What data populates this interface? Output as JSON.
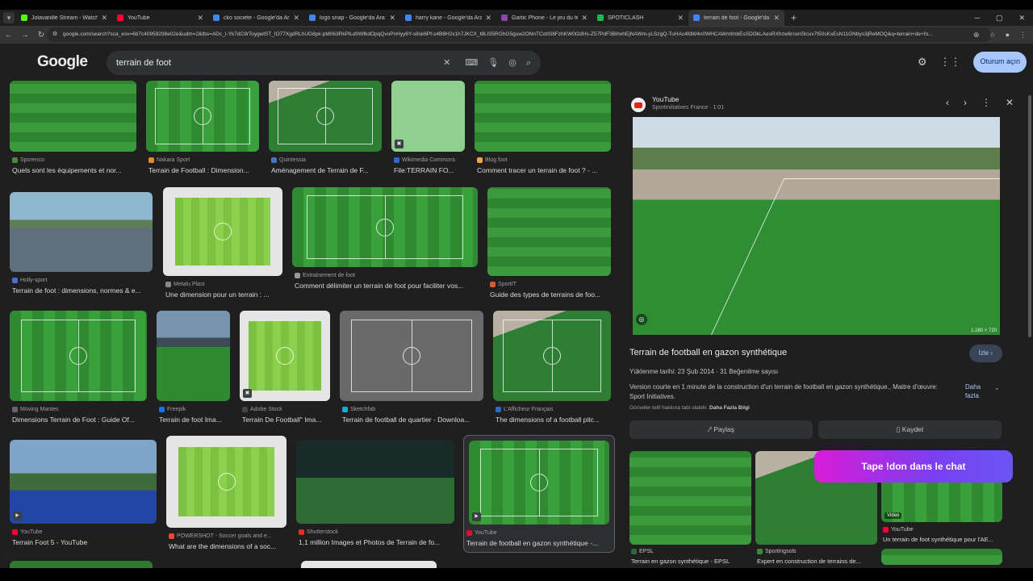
{
  "browser": {
    "tabs": [
      {
        "title": "Jolavanille Stream - Watch Live",
        "color": "#53fc18"
      },
      {
        "title": "YouTube",
        "color": "#ff0033"
      },
      {
        "title": "cko societe - Google'da Ara",
        "color": "#4285f4"
      },
      {
        "title": "logo snap - Google'da Ara",
        "color": "#4285f4"
      },
      {
        "title": "harry kane - Google'da Ara",
        "color": "#4285f4"
      },
      {
        "title": "Gartic Phone - Le jeu du télép",
        "color": "#8e44ad"
      },
      {
        "title": "SPOTICLASH",
        "color": "#1db954"
      },
      {
        "title": "terrain de foot - Google'da Ara",
        "color": "#4285f4"
      }
    ],
    "url": "google.com/search?sca_esv=6b7c40959298e02e&udm=2&tbs=ADc_I-Yk7dC9rToygwlST_IO77XgdRLhUG8pk-pM063RkPlLd0WfkdOpqQvoPnHyy6Y-s8sk6Pf-s4B8H2x1h7JKCX_t8LlS5RGhG5guw2ONnTCotIS8FzhKW0t2dHs-Z57PdF3BihvhEjNAWm-yLSzgQ-TuHAc4fdW4n0WHCAWmfmbEsSDl3kLAesRXhzw6rcenSlcuv7t50sKsEsN11GNbys3jReMOQ&q=terrain+de+fo..."
  },
  "header": {
    "logo": "Google",
    "query": "terrain de foot",
    "signin": "Oturum açın"
  },
  "results": [
    {
      "source": "Sporenco",
      "title": "Quels sont les équipements et nor...",
      "color": "#4a8a3a"
    },
    {
      "source": "Nakara Sport",
      "title": "Terrain de Football : Dimension...",
      "color": "#e88a2a"
    },
    {
      "source": "Quintessia",
      "title": "Aménagement de Terrain de F...",
      "color": "#3a7ac8"
    },
    {
      "source": "Wikimedia Commons",
      "title": "File:TERRAIN FO...",
      "color": "#3366cc"
    },
    {
      "source": "Blog foot",
      "title": "Comment tracer un terrain de foot ? - ...",
      "color": "#f4a442"
    },
    {
      "source": "Holly-sport",
      "title": "Terrain de foot : dimensions, normes & e...",
      "color": "#4a6ed8"
    },
    {
      "source": "Metalu Plast",
      "title": "Une dimension pour un terrain : ...",
      "color": "#888888"
    },
    {
      "source": "Entrainement de foot",
      "title": "Comment délimiter un terrain de foot pour faciliter vos...",
      "color": "#999999"
    },
    {
      "source": "SportIT",
      "title": "Guide des types de terrains de foo...",
      "color": "#d85c2a"
    },
    {
      "source": "Moving Mantes",
      "title": "Dimensions Terrain de Foot : Guide Of...",
      "color": "#666666"
    },
    {
      "source": "Freepik",
      "title": "Terrain de foot Ima...",
      "color": "#1273eb"
    },
    {
      "source": "Adobe Stock",
      "title": "Terrain De Football\" Ima...",
      "color": "#444444"
    },
    {
      "source": "Sketchfab",
      "title": "Terrain de football de quartier - Downloa...",
      "color": "#1caad9"
    },
    {
      "source": "L'Afficheur Français",
      "title": "The dimensions of a football pitc...",
      "color": "#2a6ac8"
    },
    {
      "source": "YouTube",
      "title": "Terrain Foot 5 - YouTube",
      "color": "#ff0033"
    },
    {
      "source": "POWERSHOT - Soccer goals and e...",
      "title": "What are the dimensions of a soc...",
      "color": "#e84a2a"
    },
    {
      "source": "Shutterstock",
      "title": "1,1 million Images et Photos de Terrain de fo...",
      "color": "#ee2b24"
    },
    {
      "source": "YouTube",
      "title": "Terrain de football en gazon synthétique -...",
      "color": "#ff0033"
    }
  ],
  "panel": {
    "channel": "YouTube",
    "subtitle": "Sportinitiatives France · 1:01",
    "dimensions": "1.280 × 720",
    "title": "Terrain de football en gazon synthétique",
    "watch": "İzle",
    "meta": "Yüklenme tarihi: 23 Şub 2014 · 31 Beğenilme sayısı",
    "description": "Version courte en 1 minute de la construction d'un terrain de football en gazon synthétique., Maitre d'œuvre: Sport Initiatives.",
    "more": "Daha fazla",
    "rights_prefix": "Görseller telif hakkına tabi olabilir.",
    "rights_link": "Daha Fazla Bilgi",
    "share": "Paylaş",
    "save": "Kaydet",
    "related": [
      {
        "source": "EPSL",
        "title": "Terrain en gazon synthétique - EPSL",
        "color": "#2a6a3a"
      },
      {
        "source": "Sportingsols",
        "title": "Expert en construction de terrains de...",
        "color": "#3a8a3a"
      },
      {
        "source": "YouTube",
        "title": "Un terrain de foot synthétique pour l'AE...",
        "color": "#ff0033",
        "badge": "Video"
      }
    ]
  },
  "overlay": "Tape !don dans le chat"
}
